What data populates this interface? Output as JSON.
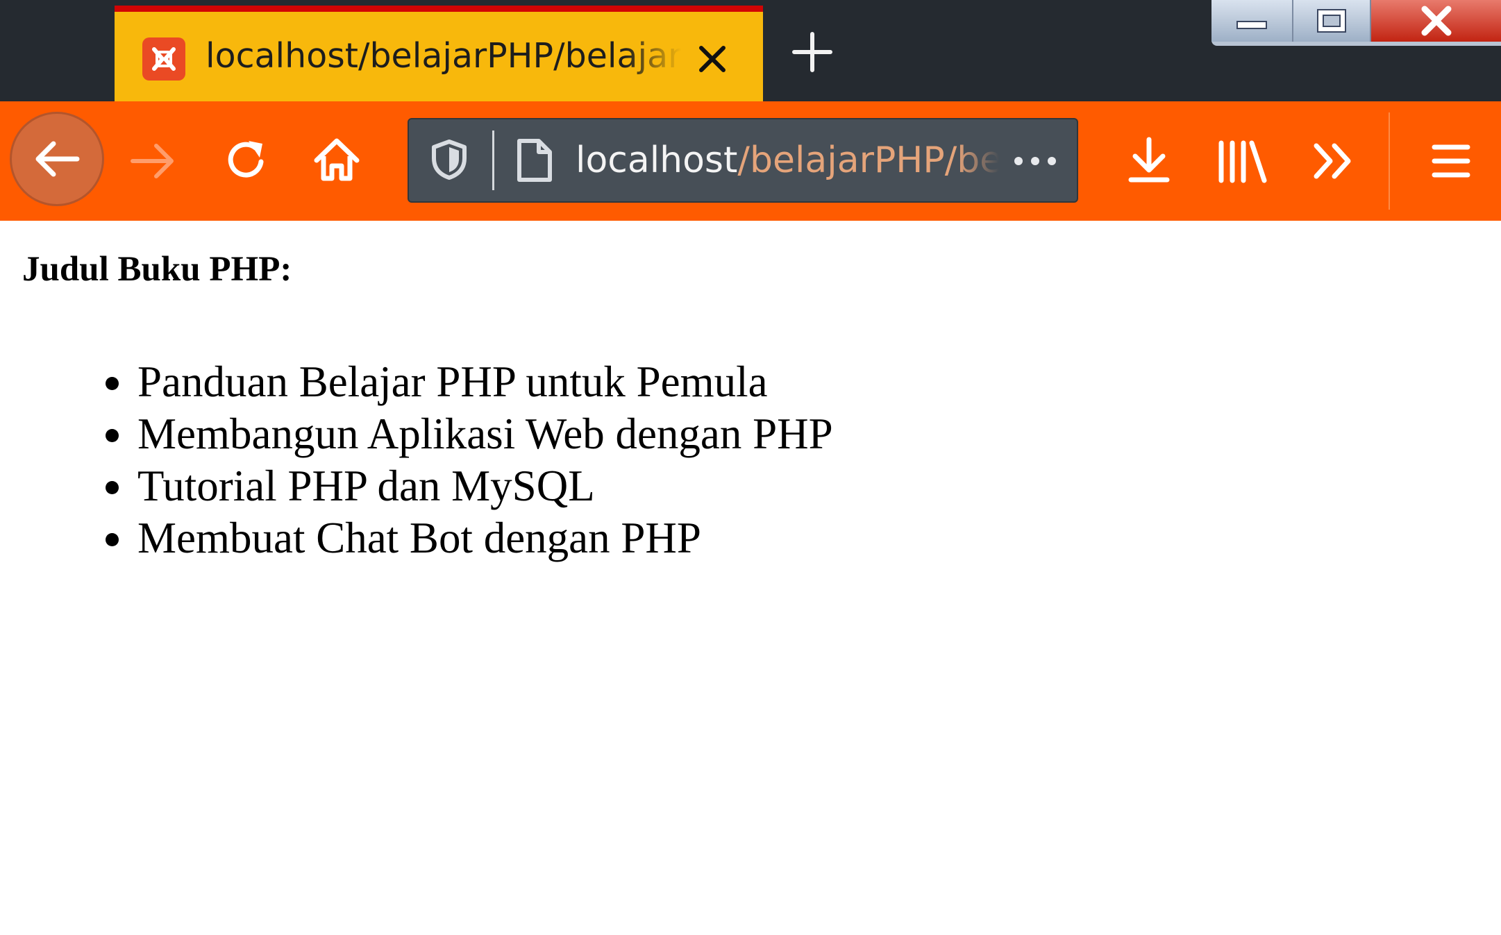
{
  "browser": {
    "tab": {
      "title": "localhost/belajarPHP/belajar.php",
      "favicon": "xampp-icon"
    },
    "new_tab_icon": "plus-icon",
    "window_controls": [
      "minimize-icon",
      "maximize-icon",
      "close-icon"
    ],
    "toolbar": {
      "back_icon": "arrow-left-icon",
      "forward_icon": "arrow-right-icon",
      "reload_icon": "reload-icon",
      "home_icon": "home-icon",
      "downloads_icon": "download-icon",
      "library_icon": "library-icon",
      "overflow_icon": "chevrons-right-icon",
      "menu_icon": "hamburger-icon"
    },
    "url": {
      "host": "localhost",
      "path": "/belajarPHP/belajar.php",
      "shield_icon": "shield-icon",
      "page_icon": "page-icon",
      "more_icon": "more-dots-icon"
    },
    "colors": {
      "tab_bar": "#252a30",
      "active_tab": "#f8b80c",
      "tab_accent": "#d10404",
      "toolbar": "#ff5b00",
      "urlbar": "#474f57"
    }
  },
  "page": {
    "heading": "Judul Buku PHP:",
    "books": [
      "Panduan Belajar PHP untuk Pemula",
      "Membangun Aplikasi Web dengan PHP",
      "Tutorial PHP dan MySQL",
      "Membuat Chat Bot dengan PHP"
    ]
  }
}
